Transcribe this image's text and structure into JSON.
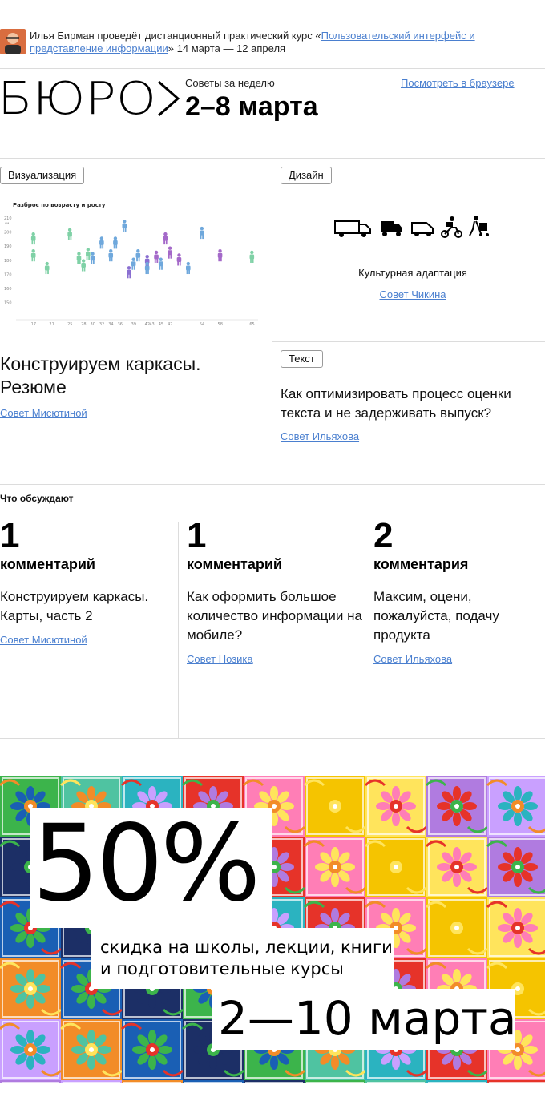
{
  "announcement": {
    "avatar_label": "Илья Бирман",
    "prefix": "Илья Бирман проведёт дистанционный практический курс «",
    "course_link": "Пользовательский интерфейс и представление информации",
    "suffix": "» 14 марта — 12 апреля"
  },
  "header": {
    "logo_text": "БЮРО",
    "weekly_label": "Советы за неделю",
    "dates": "2–8 марта",
    "browser_link": "Посмотреть в браузере"
  },
  "articles": {
    "visualization": {
      "tag": "Визуализация",
      "title": "Конструируем каркасы. Резюме",
      "author": "Совет Мисютиной"
    },
    "design": {
      "tag": "Дизайн",
      "caption": "Культурная адаптация",
      "author": "Совет Чикина",
      "icons": [
        "truck-icon",
        "truck-icon",
        "van-icon",
        "scooter-icon",
        "person-cart-icon"
      ]
    },
    "text": {
      "tag": "Текст",
      "title": "Как оптимизировать процесс оценки текста и не задерживать выпуск?",
      "author": "Совет Ильяхова"
    }
  },
  "chart_data": {
    "type": "scatter",
    "title": "Разброс по возрасту и росту",
    "xlabel": "",
    "ylabel": "",
    "y_ticks": [
      "210",
      "200",
      "190",
      "180",
      "170",
      "160",
      "150"
    ],
    "y_unit": "см",
    "x_ticks": [
      "17",
      "21",
      "25",
      "28",
      "30",
      "32",
      "34",
      "36",
      "39",
      "42",
      "43",
      "45",
      "47",
      "54",
      "58",
      "65"
    ],
    "xlim": [
      16,
      66
    ],
    "ylim": [
      146,
      212
    ],
    "colors": [
      "#7fd1a6",
      "#6fa8dc",
      "#8a6fd1",
      "#a469c9"
    ],
    "points": [
      {
        "x": 17,
        "y": 196,
        "c": 0
      },
      {
        "x": 17,
        "y": 184,
        "c": 0
      },
      {
        "x": 20,
        "y": 175,
        "c": 0
      },
      {
        "x": 25,
        "y": 199,
        "c": 0
      },
      {
        "x": 27,
        "y": 182,
        "c": 0
      },
      {
        "x": 28,
        "y": 177,
        "c": 0
      },
      {
        "x": 29,
        "y": 185,
        "c": 0
      },
      {
        "x": 30,
        "y": 182,
        "c": 1
      },
      {
        "x": 32,
        "y": 193,
        "c": 1
      },
      {
        "x": 34,
        "y": 184,
        "c": 1
      },
      {
        "x": 35,
        "y": 193,
        "c": 1
      },
      {
        "x": 37,
        "y": 205,
        "c": 1
      },
      {
        "x": 38,
        "y": 172,
        "c": 2
      },
      {
        "x": 39,
        "y": 178,
        "c": 1
      },
      {
        "x": 40,
        "y": 184,
        "c": 1
      },
      {
        "x": 42,
        "y": 180,
        "c": 2
      },
      {
        "x": 42,
        "y": 175,
        "c": 1
      },
      {
        "x": 44,
        "y": 183,
        "c": 3
      },
      {
        "x": 45,
        "y": 178,
        "c": 1
      },
      {
        "x": 46,
        "y": 196,
        "c": 3
      },
      {
        "x": 47,
        "y": 186,
        "c": 3
      },
      {
        "x": 49,
        "y": 181,
        "c": 3
      },
      {
        "x": 51,
        "y": 175,
        "c": 1
      },
      {
        "x": 54,
        "y": 200,
        "c": 1
      },
      {
        "x": 58,
        "y": 184,
        "c": 3
      },
      {
        "x": 65,
        "y": 183,
        "c": 0
      }
    ]
  },
  "discussion": {
    "title": "Что обсуждают",
    "items": [
      {
        "count": "1",
        "noun": "комментарий",
        "title": "Конструируем каркасы. Карты, часть 2",
        "author": "Совет Мисютиной"
      },
      {
        "count": "1",
        "noun": "комментарий",
        "title": "Как оформить большое количество информации на мобиле?",
        "author": "Совет Нозика"
      },
      {
        "count": "2",
        "noun": "комментария",
        "title": "Максим, оцени, пожалуйста, подачу продукта",
        "author": "Совет Ильяхова"
      }
    ]
  },
  "promo": {
    "percent": "50%",
    "line1": "скидка на школы, лекции, книги",
    "line2": "и подготовительные курсы",
    "dates": "2—10 марта",
    "tile_colors": [
      "#e63329",
      "#1a5fb4",
      "#f5c400",
      "#3cb44b",
      "#b07be0",
      "#2bb3c0",
      "#f28c28",
      "#ff7eb6",
      "#1c2f66",
      "#ffe45c",
      "#4fc3a1",
      "#c9a0ff"
    ]
  }
}
